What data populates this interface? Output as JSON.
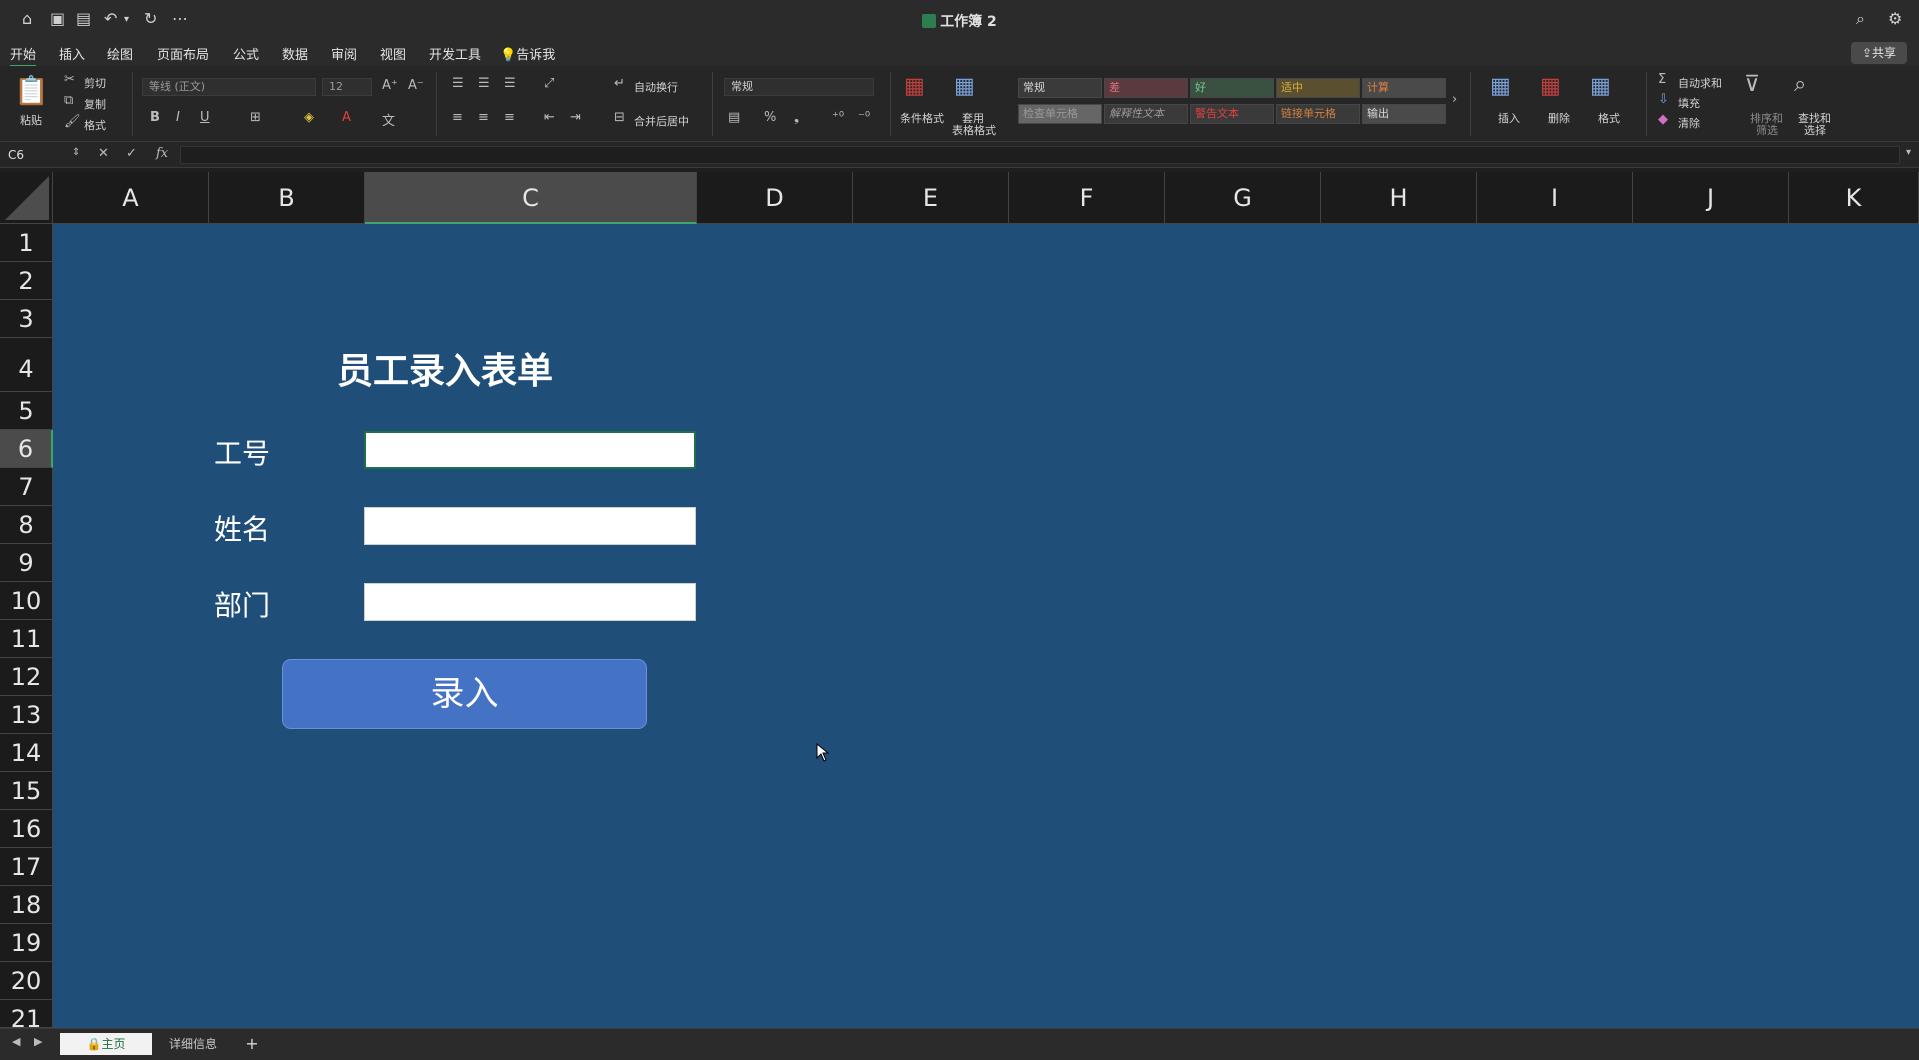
{
  "window": {
    "title": "工作簿 2"
  },
  "menu": {
    "tabs": [
      "开始",
      "插入",
      "绘图",
      "页面布局",
      "公式",
      "数据",
      "审阅",
      "视图",
      "开发工具"
    ],
    "tell_me": "告诉我",
    "share": "共享"
  },
  "ribbon": {
    "paste": "粘贴",
    "cut": "剪切",
    "copy": "复制",
    "format_painter": "格式",
    "font_name": "等线 (正文)",
    "font_size": "12",
    "wrap_text": "自动换行",
    "merge_center": "合并后居中",
    "number_format": "常规",
    "conditional_format": "条件格式",
    "table_format_1": "套用",
    "table_format_2": "表格格式",
    "styles": {
      "normal": "常规",
      "bad": "差",
      "good": "好",
      "neutral": "适中",
      "calculation": "计算",
      "check_cell": "检查单元格",
      "explanatory": "解释性文本",
      "warning": "警告文本",
      "linked_cell": "链接单元格",
      "output": "输出"
    },
    "insert": "插入",
    "delete": "删除",
    "format": "格式",
    "autosum": "自动求和",
    "fill": "填充",
    "clear": "清除",
    "sort_filter_1": "排序和",
    "sort_filter_2": "筛选",
    "find_select_1": "查找和",
    "find_select_2": "选择"
  },
  "formula_bar": {
    "name_box": "C6",
    "fx": "fx"
  },
  "columns": [
    "A",
    "B",
    "C",
    "D",
    "E",
    "F",
    "G",
    "H",
    "I",
    "J",
    "K"
  ],
  "rows": [
    "1",
    "2",
    "3",
    "4",
    "5",
    "6",
    "7",
    "8",
    "9",
    "10",
    "11",
    "12",
    "13",
    "14",
    "15",
    "16",
    "17",
    "18",
    "19",
    "20",
    "21"
  ],
  "form": {
    "title": "员工录入表单",
    "fields": [
      {
        "label": "工号",
        "value": ""
      },
      {
        "label": "姓名",
        "value": ""
      },
      {
        "label": "部门",
        "value": ""
      }
    ],
    "submit": "录入"
  },
  "sheet_tabs": {
    "home": "主页",
    "detail": "详细信息",
    "add": "+"
  },
  "colors": {
    "sheet_bg": "#1f4e79",
    "button": "#4472c4",
    "accent": "#3ea66a"
  }
}
